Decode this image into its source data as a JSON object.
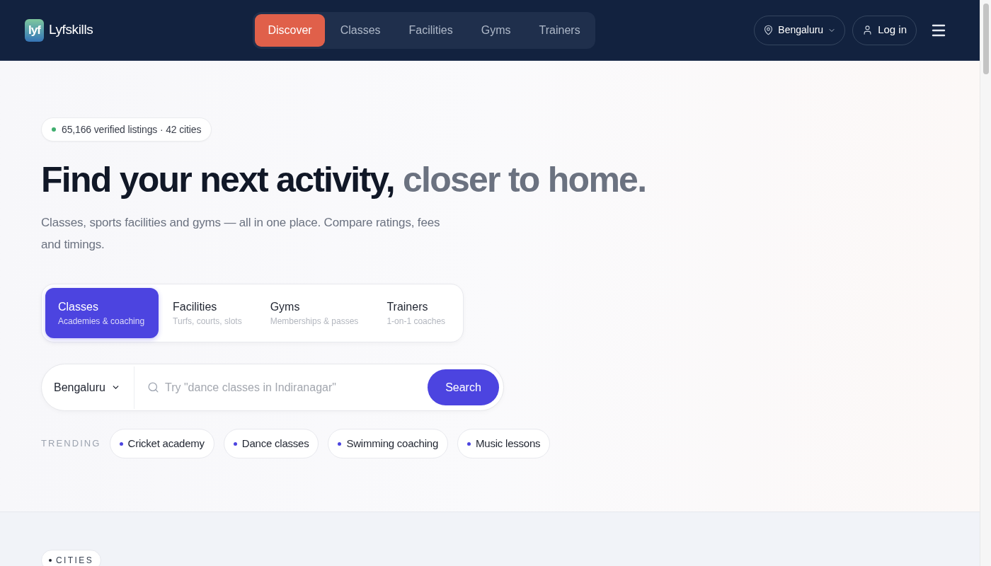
{
  "header": {
    "logo": {
      "mark": "lyf",
      "name": "Lyfskills"
    },
    "nav": [
      {
        "label": "Discover",
        "selected": true
      },
      {
        "label": "Classes",
        "selected": false
      },
      {
        "label": "Facilities",
        "selected": false
      },
      {
        "label": "Gyms",
        "selected": false
      },
      {
        "label": "Trainers",
        "selected": false
      }
    ],
    "city": "Bengaluru",
    "login": "Log in"
  },
  "hero": {
    "badge": "65,166 verified listings · 42 cities",
    "headline": {
      "lead": "Find your next activity,",
      "accent": "closer to home."
    },
    "subtitle": "Classes, sports facilities and gyms — all in one place. Compare ratings, fees and timings.",
    "categories": [
      {
        "title": "Classes",
        "subtitle": "Academies & coaching",
        "selected": true
      },
      {
        "title": "Facilities",
        "subtitle": "Turfs, courts, slots",
        "selected": false
      },
      {
        "title": "Gyms",
        "subtitle": "Memberships & passes",
        "selected": false
      },
      {
        "title": "Trainers",
        "subtitle": "1-on-1 coaches",
        "selected": false
      }
    ],
    "search": {
      "city": "Bengaluru",
      "placeholder": "Try \"dance classes in Indiranagar\"",
      "button": "Search"
    },
    "trending": {
      "label": "TRENDING",
      "items": [
        "Cricket academy",
        "Dance classes",
        "Swimming coaching",
        "Music lessons"
      ]
    }
  },
  "cities_section": {
    "tag": "CITIES"
  }
}
